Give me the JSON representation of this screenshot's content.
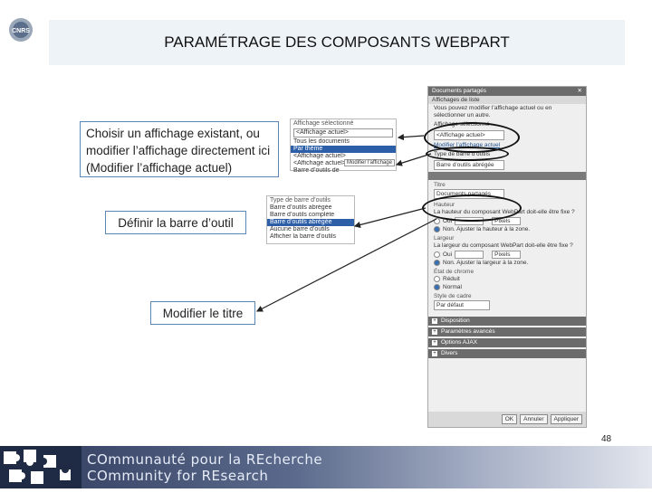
{
  "logo": {
    "text": "CNRS",
    "icon": "cnrs-logo-icon"
  },
  "slide": {
    "title": "PARAMÉTRAGE DES COMPOSANTS WEBPART",
    "page_number": "48"
  },
  "callouts": {
    "c1": "Choisir un affichage existant, ou modifier l’affichage directement ici (Modifier l’affichage actuel)",
    "c2": "Définir la barre d’outil",
    "c3": "Modifier le titre"
  },
  "shot1": {
    "header": "Affichage sélectionné",
    "selected": "<Affichage actuel>",
    "options": [
      "Tous les documents",
      "Par thème",
      "<Affichage actuel>",
      "<Affichage actuel>",
      "Barre d’outils de"
    ],
    "hl_index": 1,
    "link": "Modifier l’affichage"
  },
  "shot2": {
    "header": "Type de barre d’outils",
    "options": [
      "Barre d’outils abrégée",
      "Barre d’outils complète",
      "Barre d’outils abrégée",
      "Aucune barre d’outils",
      "Afficher la barre d’outils"
    ],
    "hl_index": 2
  },
  "panel": {
    "title": "Documents partagés",
    "subtitle": "Affichages de liste",
    "desc": "Vous pouvez modifier l’affichage actuel ou en sélectionner un autre.",
    "selected_label": "Affichage sélectionné",
    "selected_value": "<Affichage actuel>",
    "edit_link": "Modifier l’affichage actuel",
    "toolbar_label": "Type de barre d’outils",
    "toolbar_value": "Barre d’outils abrégée",
    "title_label": "Titre",
    "title_value": "Documents partagés",
    "height_label": "Hauteur",
    "height_question": "La hauteur du composant WebPart doit-elle être fixe ?",
    "yes": "Oui",
    "pixels": "Pixels",
    "height_no": "Non. Ajuster la hauteur à la zone.",
    "width_label": "Largeur",
    "width_question": "La largeur du composant WebPart doit-elle être fixe ?",
    "width_no": "Non. Ajuster la largeur à la zone.",
    "chrome_label": "État de chrome",
    "chrome_options": [
      "Réduit",
      "Normal"
    ],
    "style_label": "Style de cadre",
    "style_value": "Par défaut",
    "sections": [
      "Disposition",
      "Paramètres avancés",
      "Options AJAX",
      "Divers"
    ],
    "buttons": {
      "ok": "OK",
      "cancel": "Annuler",
      "apply": "Appliquer"
    }
  },
  "footer": {
    "line1": "COmmunauté pour la REcherche",
    "line2": "COmmunity for REsearch"
  },
  "colors": {
    "title_bg": "#eef3f8",
    "callout_border": "#5a86b8",
    "panel_header": "#6b6b6b",
    "highlight": "#2d5fa8"
  }
}
